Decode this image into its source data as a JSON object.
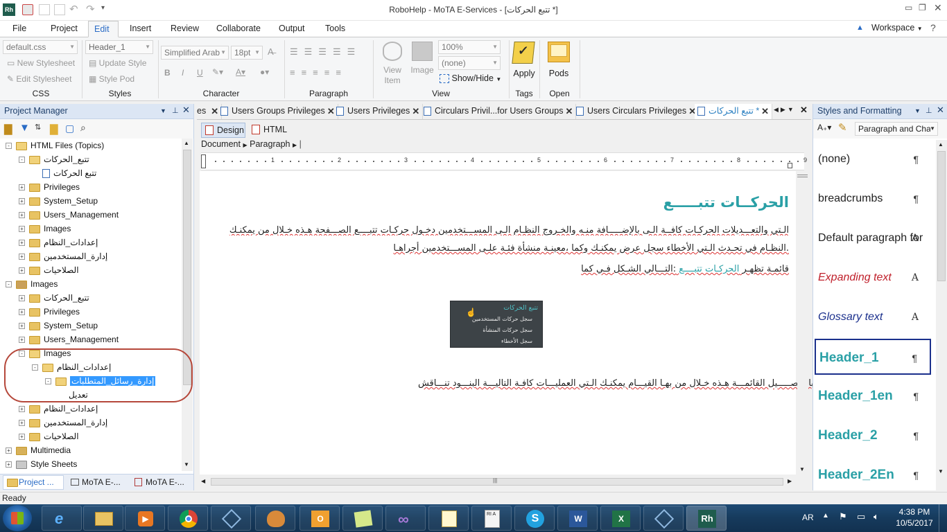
{
  "window": {
    "title": "RoboHelp - MoTA E-Services - [تتبع الحركات *]",
    "app_badge": "Rh"
  },
  "menu": {
    "items": [
      "File",
      "Project",
      "Edit",
      "Insert",
      "Review",
      "Collaborate",
      "Output",
      "Tools"
    ],
    "active": "Edit",
    "workspace_label": "Workspace"
  },
  "ribbon": {
    "css": {
      "stylesheet": "default.css",
      "new_stylesheet": "New Stylesheet",
      "edit_stylesheet": "Edit Stylesheet",
      "label": "CSS"
    },
    "styles": {
      "current": "Header_1",
      "update_style": "Update Style",
      "style_pod": "Style Pod",
      "label": "Styles"
    },
    "character": {
      "font": "Simplified Arab",
      "size": "18pt",
      "label": "Character"
    },
    "paragraph": {
      "label": "Paragraph"
    },
    "view": {
      "view_item": "View Item",
      "image": "Image",
      "zoom": "100%",
      "none": "(none)",
      "show_hide": "Show/Hide",
      "label": "View"
    },
    "tags": {
      "apply": "Apply",
      "label": "Tags"
    },
    "open": {
      "pods": "Pods",
      "label": "Open"
    }
  },
  "project_manager": {
    "title": "Project Manager",
    "tree": [
      {
        "label": "HTML Files (Topics)",
        "level": 0,
        "icon": "folder-open",
        "exp": "-"
      },
      {
        "label": "تتبع_الحركات",
        "level": 1,
        "icon": "folder-open",
        "exp": "-"
      },
      {
        "label": "تتبع الحركات",
        "level": 2,
        "icon": "topic"
      },
      {
        "label": "Privileges",
        "level": 1,
        "icon": "folder",
        "exp": "+"
      },
      {
        "label": "System_Setup",
        "level": 1,
        "icon": "folder",
        "exp": "+"
      },
      {
        "label": "Users_Management",
        "level": 1,
        "icon": "folder",
        "exp": "+"
      },
      {
        "label": "Images",
        "level": 1,
        "icon": "folder",
        "exp": "+"
      },
      {
        "label": "إعدادات_النظام",
        "level": 1,
        "icon": "folder",
        "exp": "+"
      },
      {
        "label": "إدارة_المستخدمين",
        "level": 1,
        "icon": "folder",
        "exp": "+"
      },
      {
        "label": "الصلاحيات",
        "level": 1,
        "icon": "folder",
        "exp": "+"
      },
      {
        "label": "Images",
        "level": 0,
        "icon": "images-folder",
        "exp": "-"
      },
      {
        "label": "تتبع_الحركات",
        "level": 1,
        "icon": "folder",
        "exp": "+"
      },
      {
        "label": "Privileges",
        "level": 1,
        "icon": "folder",
        "exp": "+"
      },
      {
        "label": "System_Setup",
        "level": 1,
        "icon": "folder",
        "exp": "+"
      },
      {
        "label": "Users_Management",
        "level": 1,
        "icon": "folder",
        "exp": "+"
      },
      {
        "label": "Images",
        "level": 1,
        "icon": "folder-open",
        "exp": "-"
      },
      {
        "label": "إعدادات_النظام",
        "level": 2,
        "icon": "folder-open",
        "exp": "-"
      },
      {
        "label": "إدارة_رسائل_المتطلبات",
        "level": 3,
        "icon": "folder-open",
        "exp": "-",
        "selected": true
      },
      {
        "label": "تعديل",
        "level": 4,
        "icon": "none"
      },
      {
        "label": "إعدادات_النظام",
        "level": 1,
        "icon": "folder",
        "exp": "+"
      },
      {
        "label": "إدارة_المستخدمين",
        "level": 1,
        "icon": "folder",
        "exp": "+"
      },
      {
        "label": "الصلاحيات",
        "level": 1,
        "icon": "folder",
        "exp": "+"
      },
      {
        "label": "Multimedia",
        "level": 0,
        "icon": "multimedia-folder",
        "exp": "+"
      },
      {
        "label": "Style Sheets",
        "level": 0,
        "icon": "stylesheet-folder",
        "exp": "+"
      }
    ],
    "bottom_tabs": [
      "Project ...",
      "MoTA E-...",
      "MoTA E-..."
    ]
  },
  "doc_tabs": [
    {
      "label": "es",
      "active": false
    },
    {
      "label": "Users Groups Privileges",
      "active": false
    },
    {
      "label": "Users Privileges",
      "active": false
    },
    {
      "label": "Circulars Privil...for Users Groups",
      "active": false
    },
    {
      "label": "Users Circulars Privileges",
      "active": false
    },
    {
      "label": "تتبع الحركات *",
      "active": true
    }
  ],
  "editor": {
    "design_label": "Design",
    "html_label": "HTML",
    "breadcrumb": [
      "Document",
      "Paragraph"
    ],
    "ruler_numbers": [
      "1",
      "2",
      "3",
      "4",
      "5",
      "6",
      "7",
      "8",
      "9"
    ],
    "heading": "الحركــات تتبـــــع",
    "para1_line1": "الـتي والتعـــديلات الحركـات كافــة الـى بالإضـــــافة منـه والخـروج النظـام الـى المســـتخدمين دخـول حركـات تتبــــع الصـــفحة هـذه خـلال من يمكنـك",
    "para1_line2": ".النظـام في تحـدث الـتي الأخطاء سجل عرض يمكنـك وكما ،معينـة منشأة فئـة علـى المســـتخدمين أجراهـا",
    "para2_pre": ":التـــالي الشـكل فـي كما",
    "para2_link": "الحركـات تتبــــع",
    "para2_post": "قائمـة تظهـر",
    "menu_image": {
      "title": "تتبع الحركات",
      "items": [
        "سجل حركات المستخدمين",
        "سجل حركات المنشأة",
        "سجل الأخطاء"
      ]
    },
    "para3": ".بالتفصـــــيل القائمـــة هـذه خـلال من بهـا القيـــام يمكنـك الـتي العمليـــات كافـة التاليـــة البنـــود تنـــاقش"
  },
  "styles_panel": {
    "title": "Styles and Formatting",
    "filter": "Paragraph and Char",
    "items": [
      {
        "name": "(none)",
        "mark": "¶",
        "color": "#222222",
        "style": "normal"
      },
      {
        "name": "breadcrumbs",
        "mark": "¶",
        "color": "#222222",
        "style": "normal"
      },
      {
        "name": "Default paragraph for",
        "mark": "A",
        "color": "#222222",
        "style": "normal"
      },
      {
        "name": "Expanding text",
        "mark": "A",
        "color": "#c0202b",
        "style": "italic"
      },
      {
        "name": "Glossary text",
        "mark": "A",
        "color": "#1a2f8c",
        "style": "italic"
      },
      {
        "name": "Header_1",
        "mark": "¶",
        "color": "#2aa0a6",
        "style": "bold",
        "selected": true
      },
      {
        "name": "Header_1en",
        "mark": "¶",
        "color": "#2aa0a6",
        "style": "bold"
      },
      {
        "name": "Header_2",
        "mark": "¶",
        "color": "#2aa0a6",
        "style": "bold"
      },
      {
        "name": "Header_2En",
        "mark": "¶",
        "color": "#2aa0a6",
        "style": "bold"
      }
    ]
  },
  "status": {
    "text": "Ready"
  },
  "taskbar": {
    "lang": "AR",
    "time": "4:38 PM",
    "date": "10/5/2017"
  },
  "colors": {
    "accent": "#2a6cc6",
    "heading": "#2aa0a6",
    "selection": "#3399ff",
    "annotation": "#b5473a",
    "taskbar": "#163a5c"
  }
}
